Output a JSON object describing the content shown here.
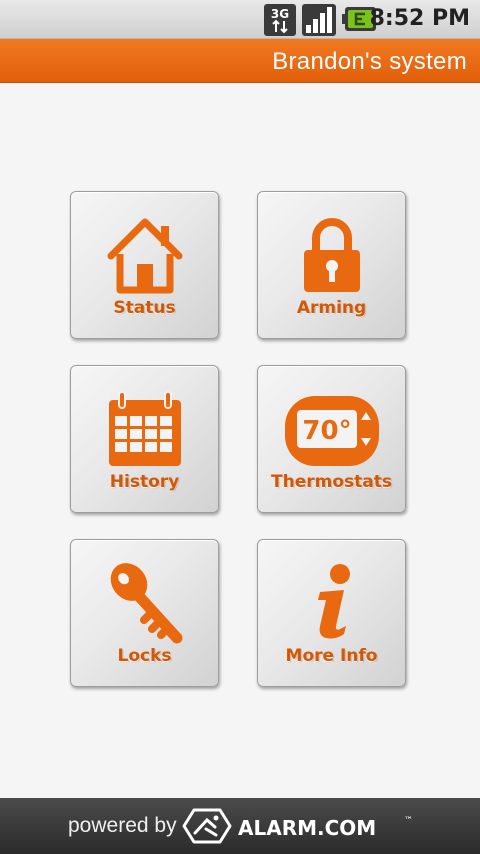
{
  "status_bar": {
    "network_label": "3G",
    "time": "8:52 PM",
    "icons": [
      "3g-data-icon",
      "signal-strength-icon",
      "battery-charging-icon"
    ]
  },
  "header": {
    "title": "Brandon's system"
  },
  "colors": {
    "accent": "#e8690f",
    "tile_label": "#d35806",
    "footer_bg": "#333333"
  },
  "tiles": [
    {
      "label": "Status",
      "icon": "house-icon"
    },
    {
      "label": "Arming",
      "icon": "padlock-icon"
    },
    {
      "label": "History",
      "icon": "calendar-icon"
    },
    {
      "label": "Thermostats",
      "icon": "thermostat-icon",
      "icon_text": "70°"
    },
    {
      "label": "Locks",
      "icon": "key-icon"
    },
    {
      "label": "More Info",
      "icon": "info-icon"
    }
  ],
  "footer": {
    "powered_by": "powered by",
    "brand": "ALARM.COM",
    "trademark": "™"
  }
}
